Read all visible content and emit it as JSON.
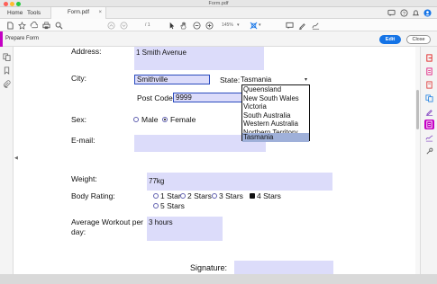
{
  "window": {
    "title": "Form.pdf"
  },
  "tabbar": {
    "home_label": "Home",
    "tools_label": "Tools",
    "doc_tab_label": "Form.pdf",
    "doc_tab_close": "×"
  },
  "toolbar": {
    "page_current": "",
    "page_separator": "/ 1",
    "zoom": "145%"
  },
  "prepare_bar": {
    "label": "Prepare Form",
    "edit_label": "Edit",
    "close_label": "Close"
  },
  "form": {
    "address_label": "Address:",
    "address_value": "1 Smith Avenue",
    "city_label": "City:",
    "city_value": "Smithville",
    "state_label": "State:",
    "state_value": "Tasmania",
    "state_options": [
      "Queensland",
      "New South Wales",
      "Victoria",
      "South Australia",
      "Western Australia",
      "Northern Territory",
      "Tasmania"
    ],
    "state_selected_index": 6,
    "postcode_label": "Post Code:",
    "postcode_value": "9999",
    "sex_label": "Sex:",
    "sex_options": [
      "Male",
      "Female"
    ],
    "sex_selected": "Female",
    "email_label": "E-mail:",
    "email_value": "",
    "weight_label": "Weight:",
    "weight_value": "77kg",
    "rating_label": "Body Rating:",
    "rating_options": [
      "1 Star",
      "2 Stars",
      "3 Stars",
      "4 Stars",
      "5 Stars"
    ],
    "rating_selected": "4 Stars",
    "workout_label_line1": "Average Workout per",
    "workout_label_line2": "day:",
    "workout_value": "3 hours",
    "signature_label": "Signature:"
  },
  "colors": {
    "accent": "#c400c4",
    "edit_button": "#1473e6",
    "field_fill": "#dcdcfa",
    "list_selected": "#9fb0d9"
  },
  "icons": {
    "toolbar": [
      "new-doc-icon",
      "bookmark-star-icon",
      "upload-icon",
      "print-icon",
      "search-icon",
      "page-up-icon",
      "page-down-icon",
      "select-arrow-icon",
      "hand-icon",
      "zoom-out-icon",
      "zoom-in-icon",
      "fit-page-icon",
      "comment-icon",
      "highlight-icon",
      "sign-icon"
    ],
    "right_rail": [
      "export-pdf-icon",
      "edit-pdf-icon",
      "create-pdf-icon",
      "combine-files-icon",
      "fill-sign-icon",
      "prepare-form-icon",
      "send-for-signature-icon",
      "more-tools-icon"
    ]
  }
}
